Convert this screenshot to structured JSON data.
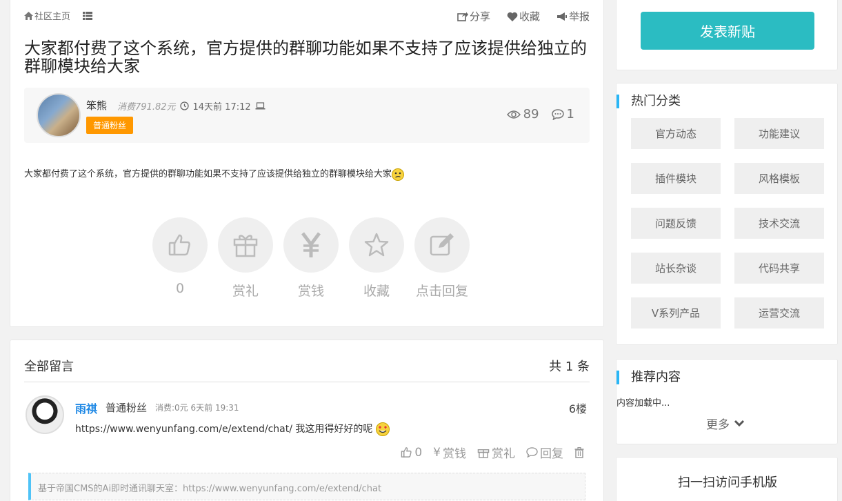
{
  "topbar": {
    "home": "社区主页",
    "share": "分享",
    "favorite": "收藏",
    "report": "举报"
  },
  "post": {
    "title": "大家都付费了这个系统，官方提供的群聊功能如果不支持了应该提供给独立的群聊模块给大家",
    "author": "笨熊",
    "cost": "消费791.82元",
    "time": "14天前 17:12",
    "badge": "普通粉丝",
    "views": "89",
    "replies": "1",
    "content": "大家都付费了这个系统，官方提供的群聊功能如果不支持了应该提供给独立的群聊模块给大家"
  },
  "actions": [
    {
      "label": "0",
      "icon": "thumbs-up-icon"
    },
    {
      "label": "赏礼",
      "icon": "gift-icon"
    },
    {
      "label": "赏钱",
      "icon": "yen-icon"
    },
    {
      "label": "收藏",
      "icon": "star-icon"
    },
    {
      "label": "点击回复",
      "icon": "edit-icon"
    }
  ],
  "comments": {
    "heading": "全部留言",
    "count": "共 1 条",
    "item": {
      "user": "雨祺",
      "rank": "普通粉丝",
      "meta": "消费:0元 6天前 19:31",
      "floor": "6楼",
      "text": "https://www.wenyunfang.com/e/extend/chat/ 我这用得好好的呢",
      "like": "0",
      "tip": "赏钱",
      "gift": "赏礼",
      "reply": "回复",
      "quote": "基于帝国CMS的Ai即时通讯聊天室：https://www.wenyunfang.com/e/extend/chat"
    }
  },
  "sidebar": {
    "post_button": "发表新贴",
    "hot_title": "热门分类",
    "categories": [
      "官方动态",
      "功能建议",
      "插件模块",
      "风格模板",
      "问题反馈",
      "技术交流",
      "站长杂谈",
      "代码共享",
      "V系列产品",
      "运营交流"
    ],
    "rec_title": "推荐内容",
    "rec_loading": "内容加载中...",
    "rec_more": "更多",
    "qr_title": "扫一扫访问手机版"
  },
  "colors": {
    "accent": "#2bbcc2",
    "badge": "#ff9800",
    "link": "#1e88e5",
    "bar": "#29b6f6"
  }
}
